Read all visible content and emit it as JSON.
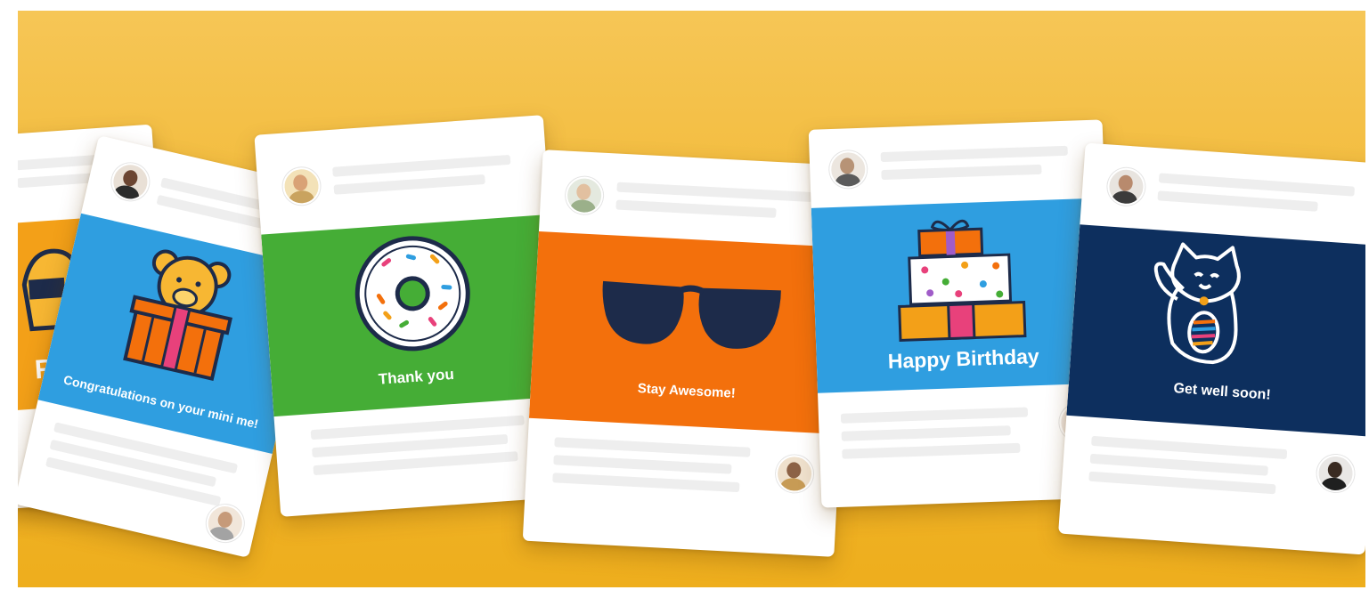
{
  "colors": {
    "background_top": "#f6c656",
    "background_bottom": "#eeae1d",
    "blue_band": "#2f9ee0",
    "green_band": "#45ad36",
    "orange_band": "#f3700c",
    "navy_band": "#0d2f5e",
    "card": "#ffffff",
    "placeholder_line": "#eeeeee"
  },
  "cards": [
    {
      "id": "partial",
      "band_color": "#f3a018",
      "message": "R",
      "illustration": "partial-illustration-icon"
    },
    {
      "id": "congrats",
      "band_color": "#2f9ee0",
      "message": "Congratulations on your mini me!",
      "illustration": "teddy-bear-gift-icon"
    },
    {
      "id": "thanks",
      "band_color": "#45ad36",
      "message": "Thank you",
      "illustration": "donut-icon"
    },
    {
      "id": "awesome",
      "band_color": "#f3700c",
      "message": "Stay Awesome!",
      "illustration": "sunglasses-icon"
    },
    {
      "id": "birthday",
      "band_color": "#2f9ee0",
      "message": "Happy Birthday",
      "illustration": "stacked-gifts-icon"
    },
    {
      "id": "getwell",
      "band_color": "#0d2f5e",
      "message": "Get well soon!",
      "illustration": "lucky-cat-icon"
    }
  ]
}
